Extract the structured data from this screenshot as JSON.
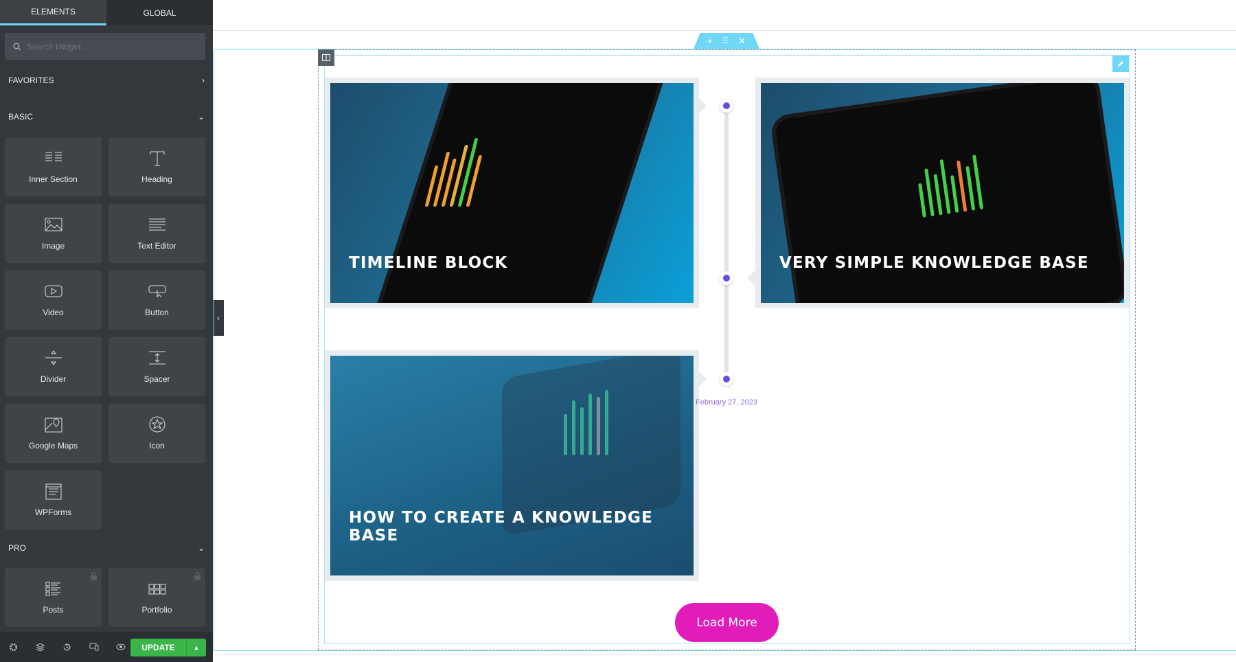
{
  "sidebar": {
    "tabs": [
      "ELEMENTS",
      "GLOBAL"
    ],
    "search_placeholder": "Search Widget...",
    "categories": {
      "favorites": "FAVORITES",
      "basic": "BASIC",
      "pro": "PRO"
    },
    "basic_widgets": [
      {
        "label": "Inner Section",
        "icon": "inner-section-icon"
      },
      {
        "label": "Heading",
        "icon": "heading-icon"
      },
      {
        "label": "Image",
        "icon": "image-icon"
      },
      {
        "label": "Text Editor",
        "icon": "text-editor-icon"
      },
      {
        "label": "Video",
        "icon": "video-icon"
      },
      {
        "label": "Button",
        "icon": "button-icon"
      },
      {
        "label": "Divider",
        "icon": "divider-icon"
      },
      {
        "label": "Spacer",
        "icon": "spacer-icon"
      },
      {
        "label": "Google Maps",
        "icon": "google-maps-icon"
      },
      {
        "label": "Icon",
        "icon": "star-icon"
      },
      {
        "label": "WPForms",
        "icon": "wpforms-icon"
      }
    ],
    "pro_widgets": [
      {
        "label": "Posts",
        "icon": "posts-icon",
        "locked": true
      },
      {
        "label": "Portfolio",
        "icon": "portfolio-icon",
        "locked": true
      }
    ],
    "update_label": "UPDATE"
  },
  "canvas": {
    "posts": [
      {
        "title": "TIMELINE BLOCK"
      },
      {
        "title": "VERY SIMPLE KNOWLEDGE BASE"
      },
      {
        "title": "HOW TO CREATE A KNOWLEDGE BASE"
      }
    ],
    "date": "February 27, 2023",
    "load_more": "Load More"
  },
  "colors": {
    "accent": "#71d7f7",
    "timeline_dot": "#6b4be0",
    "load_more": "#e11cba",
    "update": "#39b54a"
  }
}
